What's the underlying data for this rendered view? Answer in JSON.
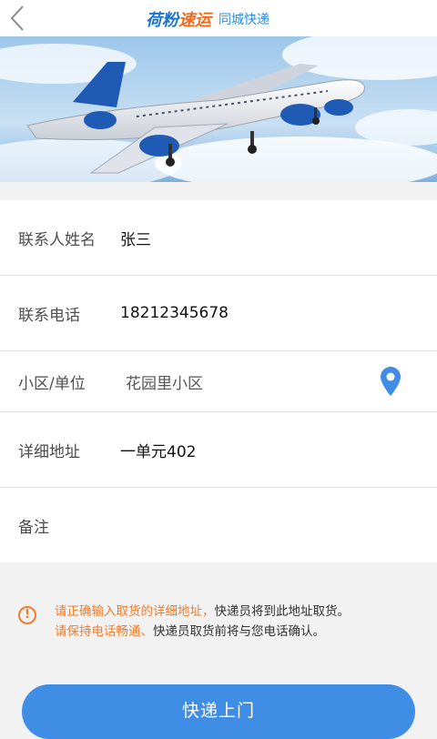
{
  "header": {
    "brand_main_a": "荷粉",
    "brand_main_b": "速运",
    "brand_sub": "同城快递"
  },
  "form": {
    "name_label": "联系人姓名",
    "name_value": "张三",
    "phone_label": "联系电话",
    "phone_value": "18212345678",
    "community_label": "小区/单位",
    "community_value": "花园里小区",
    "address_label": "详细地址",
    "address_value": "一单元402",
    "note_label": "备注",
    "note_value": ""
  },
  "notice": {
    "icon": "!",
    "line1_highlight": "请正确输入取货的详细地址，",
    "line1_rest": "快递员将到此地址取货。",
    "line2_highlight": "请保持电话畅通、",
    "line2_rest": "快递员取货前将与您电话确认。"
  },
  "submit_label": "快递上门",
  "colors": {
    "accent_blue": "#3f8de4",
    "brand_blue": "#1e74c9",
    "brand_orange": "#f26a1b",
    "notice_orange": "#ef7d2a"
  },
  "icons": {
    "back": "chevron-left-icon",
    "location": "map-pin-icon",
    "notice": "exclamation-circle-icon"
  }
}
